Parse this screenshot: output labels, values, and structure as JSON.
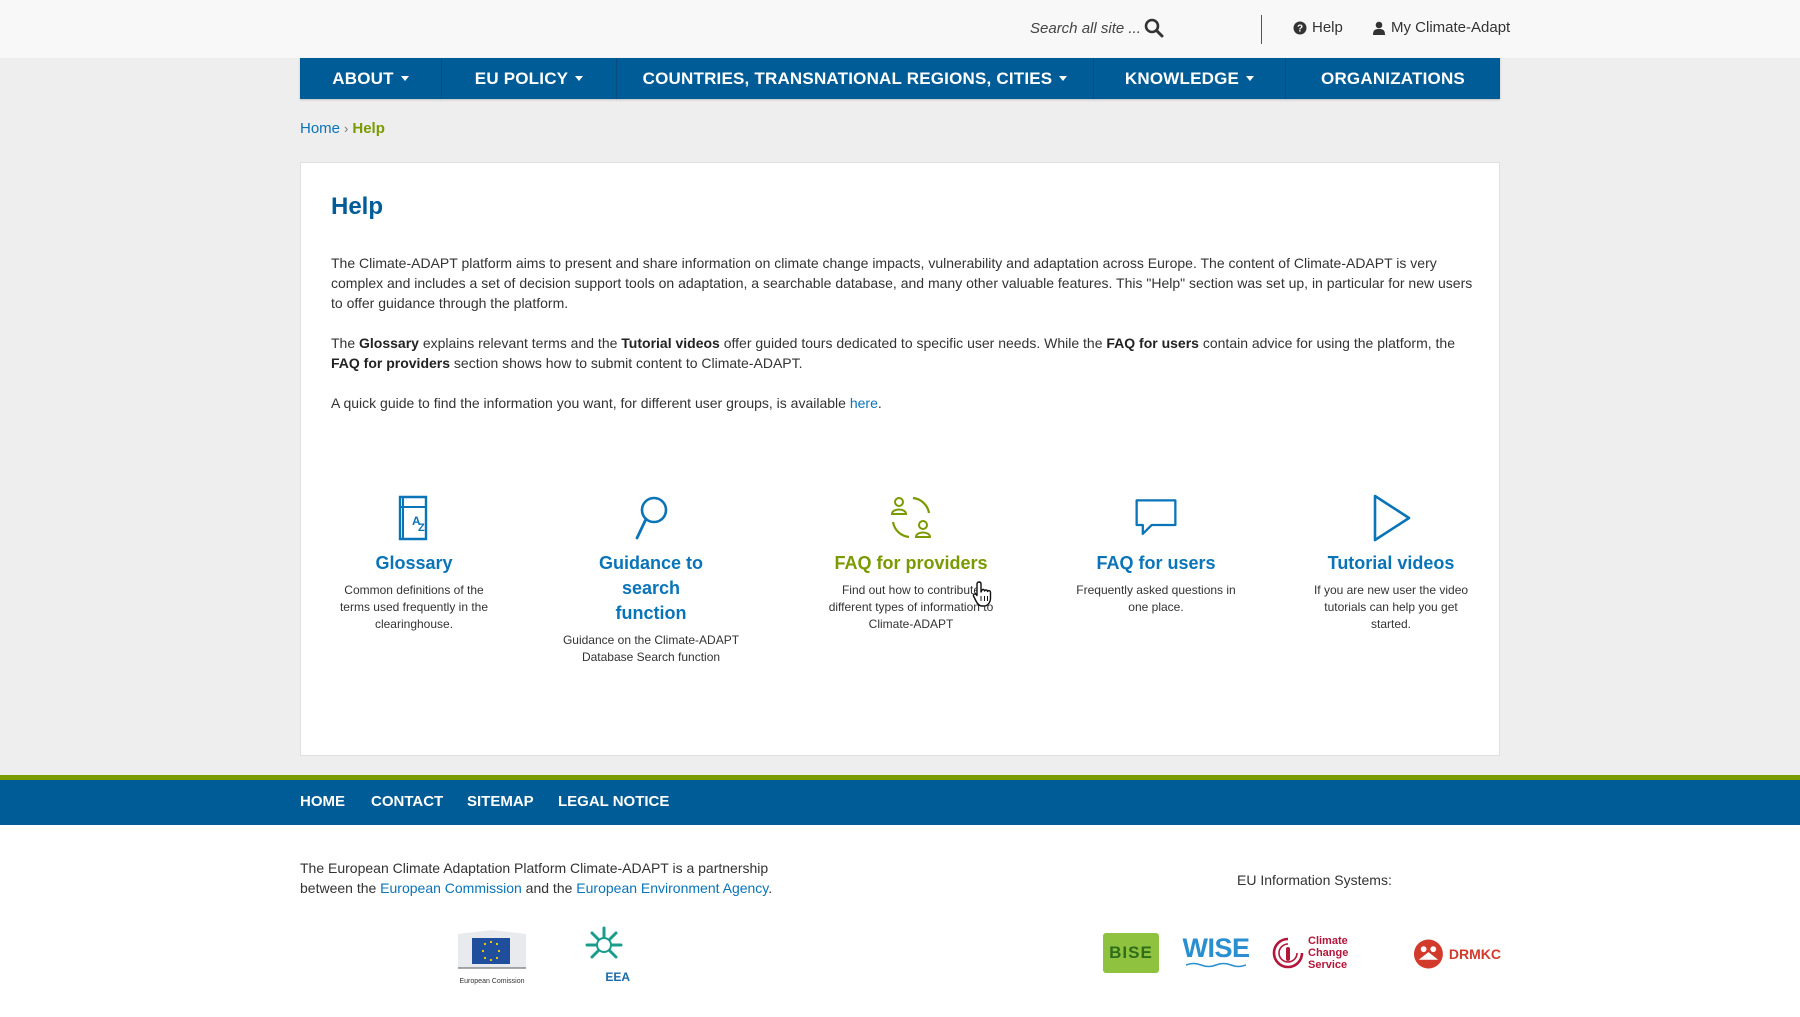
{
  "topbar": {
    "search_placeholder": "Search all site ...",
    "help_label": "Help",
    "account_label": "My Climate-Adapt"
  },
  "nav": {
    "items": [
      {
        "label": "ABOUT",
        "has_dropdown": true
      },
      {
        "label": "EU POLICY",
        "has_dropdown": true
      },
      {
        "label": "COUNTRIES, TRANSNATIONAL REGIONS, CITIES",
        "has_dropdown": true
      },
      {
        "label": "KNOWLEDGE",
        "has_dropdown": true
      },
      {
        "label": "ORGANIZATIONS",
        "has_dropdown": false
      }
    ]
  },
  "breadcrumb": {
    "home": "Home",
    "separator": "›",
    "current": "Help"
  },
  "main": {
    "title": "Help",
    "intro": "The Climate-ADAPT platform aims to present and share information on climate change impacts, vulnerability and adaptation across Europe. The content of Climate-ADAPT is very complex and includes a set of decision support tools on adaptation, a searchable database, and many other valuable features. This \"Help\" section was set up, in particular for new users to offer guidance through the platform.",
    "p2": {
      "t1": "The ",
      "b1": "Glossary",
      "t2": " explains relevant terms and the ",
      "b2": "Tutorial videos",
      "t3": " offer guided tours dedicated to specific user needs. While the ",
      "b3": "FAQ for users",
      "t4": " contain advice for using the platform, the ",
      "b4": "FAQ for providers",
      "t5": " section shows how to submit content to Climate-ADAPT."
    },
    "p3": {
      "text": "A quick guide to find the information you want, for different user groups, is available ",
      "link": "here",
      "end": "."
    },
    "features": [
      {
        "title": "Glossary",
        "desc": "Common definitions of the terms used frequently in the clearinghouse.",
        "icon": "glossary-book-icon"
      },
      {
        "title": "Guidance to search function",
        "desc": "Guidance on the Climate-ADAPT Database Search function",
        "icon": "magnifier-icon"
      },
      {
        "title": "FAQ for providers",
        "desc": "Find out how to contribute different types of information to Climate-ADAPT",
        "icon": "providers-exchange-icon"
      },
      {
        "title": "FAQ for users",
        "desc": "Frequently asked questions in one place.",
        "icon": "speech-bubble-icon"
      },
      {
        "title": "Tutorial videos",
        "desc": "If you are new user the video tutorials can help you get started.",
        "icon": "play-icon"
      }
    ]
  },
  "footer": {
    "nav": [
      "HOME",
      "CONTACT",
      "SITEMAP",
      "LEGAL NOTICE"
    ],
    "partnership": {
      "t1": "The European Climate Adaptation Platform Climate-ADAPT is a partnership",
      "t2": "between the ",
      "link1": "European Commission",
      "t3": " and the ",
      "link2": "European Environment Agency",
      "t4": "."
    },
    "eu_systems_label": "EU Information Systems:",
    "logos": {
      "ec": "European Comission",
      "eea": "EEA",
      "bise": "BISE",
      "wise": "WISE",
      "ccs": "Climate Change Service",
      "drmkc": "DRMKC"
    }
  },
  "colors": {
    "primary": "#005c96",
    "link": "#0a74b8",
    "accent_green": "#7a9a01",
    "background": "#eeeeee"
  }
}
